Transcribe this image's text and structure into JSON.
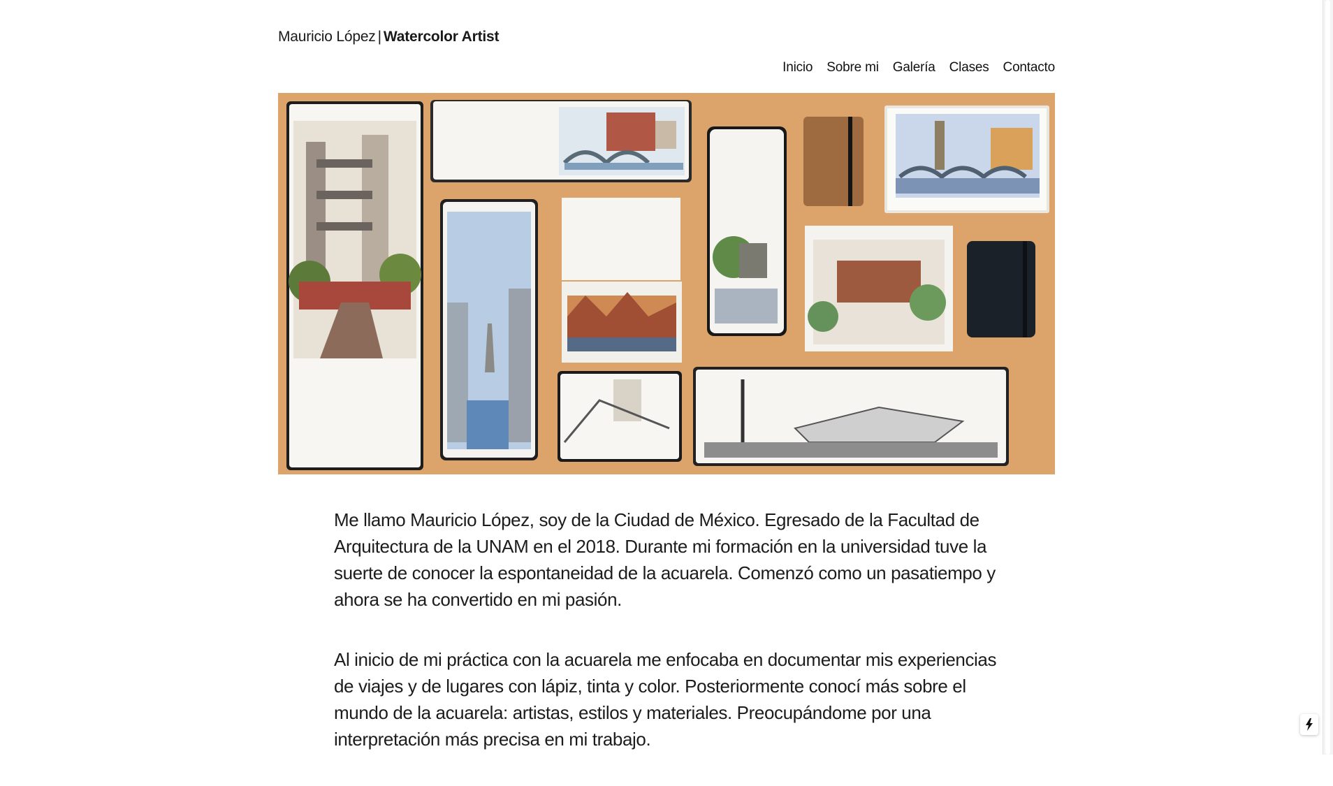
{
  "site": {
    "artist_name": "Mauricio López",
    "separator": "|",
    "role": "Watercolor Artist"
  },
  "nav": {
    "items": [
      "Inicio",
      "Sobre mi",
      "Galería",
      "Clases",
      "Contacto"
    ]
  },
  "hero": {
    "background": "#dfa66c"
  },
  "content": {
    "paragraphs": [
      "Me llamo Mauricio López, soy de la Ciudad de México. Egresado de la Facultad de Arquitectura de la UNAM en el 2018. Durante mi formación en la universidad tuve la suerte de conocer la espontaneidad de la acuarela. Comenzó como un pasatiempo y ahora se ha convertido en mi pasión.",
      "Al inicio de mi práctica con la acuarela me enfocaba en documentar mis experiencias de viajes y de lugares con lápiz, tinta y color. Posteriormente conocí más sobre el mundo de la acuarela: artistas, estilos y materiales. Preocupándome por una interpretación más precisa en mi trabajo."
    ]
  },
  "floating_button": {
    "icon": "lightning-bolt-icon"
  }
}
